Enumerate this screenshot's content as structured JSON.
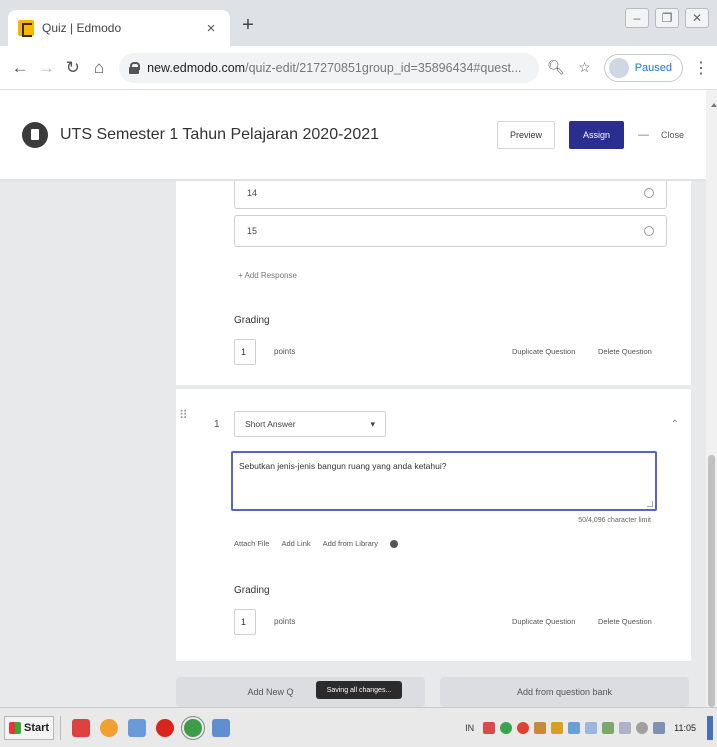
{
  "browser": {
    "tab_title": "Quiz | Edmodo",
    "tab_close": "×",
    "new_tab": "+",
    "url_host": "new.edmodo.com",
    "url_path": "/quiz-edit/217270851group_id=35896434#quest...",
    "profile_label": "Paused"
  },
  "app": {
    "quiz_title": "UTS Semester 1 Tahun Pelajaran 2020-2021",
    "preview_label": "Preview",
    "assign_label": "Assign",
    "header_sep": "—",
    "close_label": "Close"
  },
  "question_prev": {
    "options": [
      "14",
      "15"
    ],
    "add_response": "+ Add Response",
    "grading_label": "Grading",
    "points_value": "1",
    "points_label": "points",
    "duplicate_label": "Duplicate Question",
    "delete_label": "Delete Question"
  },
  "question_current": {
    "number": "1",
    "type": "Short Answer",
    "text": "Sebutkan jenis-jenis bangun ruang yang anda ketahui?",
    "char_limit": "50/4,096 character limit",
    "attach_file": "Attach File",
    "add_link": "Add Link",
    "add_library": "Add from Library",
    "grading_label": "Grading",
    "points_value": "1",
    "points_label": "points",
    "duplicate_label": "Duplicate Question",
    "delete_label": "Delete Question"
  },
  "footer": {
    "add_new": "Add New Q",
    "saving": "Saving all changes...",
    "add_bank": "Add from question bank"
  },
  "taskbar": {
    "start_label": "Start",
    "lang": "IN",
    "clock": "11:05"
  },
  "colors": {
    "assign_bg": "#2a2f8f",
    "focus_border": "#5a62c6"
  }
}
